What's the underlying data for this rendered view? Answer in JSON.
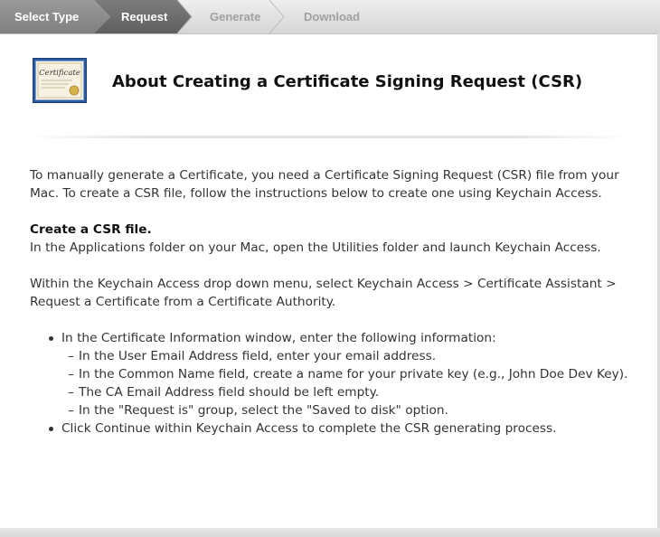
{
  "steps": [
    {
      "label": "Select Type",
      "state": "done"
    },
    {
      "label": "Request",
      "state": "current"
    },
    {
      "label": "Generate",
      "state": "todo"
    },
    {
      "label": "Download",
      "state": "todo"
    }
  ],
  "colors": {
    "step_done": "#8c8c8c",
    "step_current": "#6e6e6e",
    "step_todo": "#d8d8d8",
    "text": "#333333"
  },
  "header": {
    "icon": "certificate-icon",
    "icon_text": "Certificate",
    "title": "About Creating a Certificate Signing Request (CSR)"
  },
  "content": {
    "intro": "To manually generate a Certificate, you need a Certificate Signing Request (CSR) file from your Mac. To create a CSR file, follow the instructions below to create one using Keychain Access.",
    "subheading": "Create a CSR file.",
    "para1": "In the Applications folder on your Mac, open the Utilities folder and launch Keychain Access.",
    "para2": "Within the Keychain Access drop down menu, select Keychain Access > Certificate Assistant > Request a Certificate from a Certificate Authority.",
    "bullet1": "In the Certificate Information window, enter the following information:",
    "subitems": [
      "In the User Email Address field, enter your email address.",
      "In the Common Name field, create a name for your private key (e.g., John Doe Dev Key).",
      "The CA Email Address field should be left empty.",
      "In the \"Request is\" group, select the \"Saved to disk\" option."
    ],
    "bullet2": "Click Continue within Keychain Access to complete the CSR generating process."
  }
}
